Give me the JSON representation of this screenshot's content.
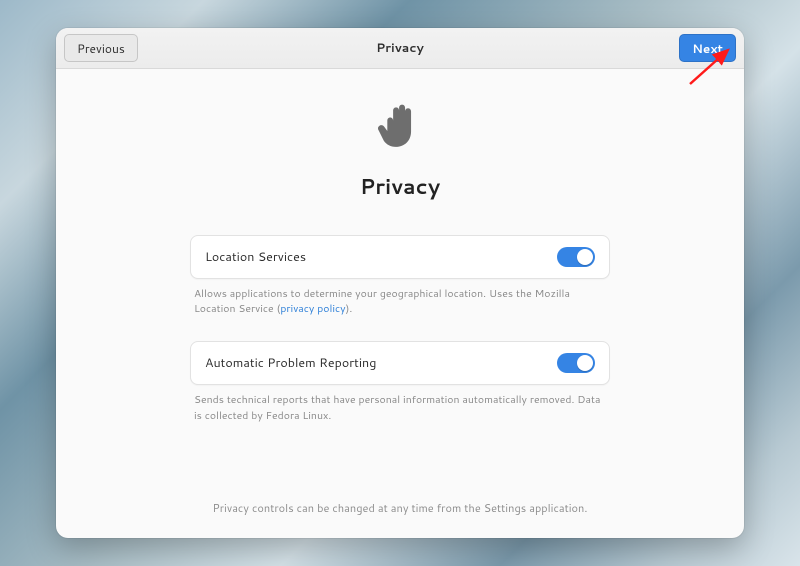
{
  "header": {
    "title": "Privacy",
    "previous_label": "Previous",
    "next_label": "Next"
  },
  "main": {
    "heading": "Privacy",
    "footer_note": "Privacy controls can be changed at any time from the Settings application."
  },
  "groups": {
    "location": {
      "label": "Location Services",
      "desc_a": "Allows applications to determine your geographical location. Uses the Mozilla Location Service (",
      "link": "privacy policy",
      "desc_b": ").",
      "switch_on": true
    },
    "problem_report": {
      "label": "Automatic Problem Reporting",
      "desc": "Sends technical reports that have personal information automatically removed. Data is collected by Fedora Linux.",
      "switch_on": true
    }
  },
  "colors": {
    "accent": "#3584e4"
  }
}
